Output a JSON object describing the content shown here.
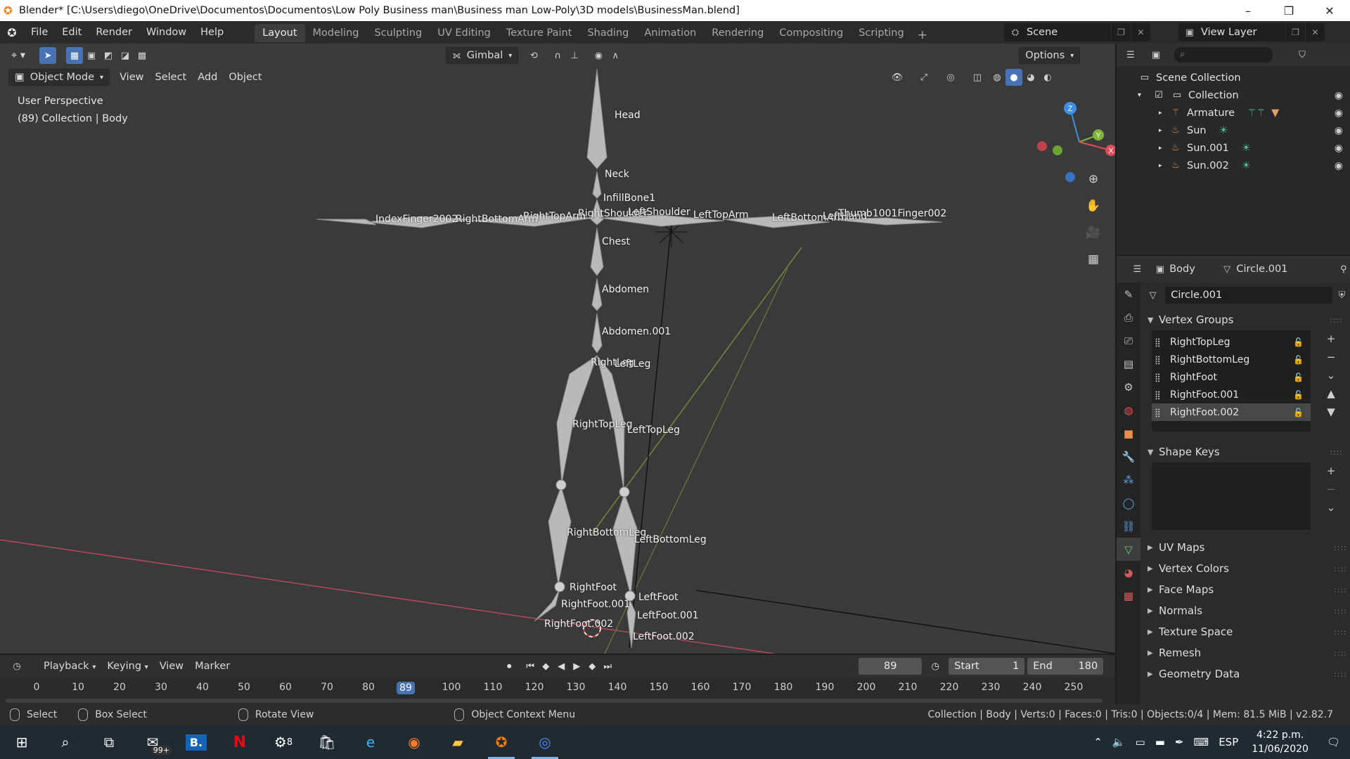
{
  "window": {
    "title": "Blender* [C:\\Users\\diego\\OneDrive\\Documentos\\Documentos\\Low Poly Business man\\Business man Low-Poly\\3D models\\BusinessMan.blend]",
    "minimize": "–",
    "maximize": "❐",
    "close": "✕"
  },
  "menu": [
    "File",
    "Edit",
    "Render",
    "Window",
    "Help"
  ],
  "workspaces": [
    "Layout",
    "Modeling",
    "Sculpting",
    "UV Editing",
    "Texture Paint",
    "Shading",
    "Animation",
    "Rendering",
    "Compositing",
    "Scripting"
  ],
  "active_workspace": "Layout",
  "add_workspace": "+",
  "scene": "Scene",
  "view_layer": "View Layer",
  "viewport": {
    "mode": "Object Mode",
    "menus": [
      "View",
      "Select",
      "Add",
      "Object"
    ],
    "orientation": "Gimbal",
    "options": "Options",
    "info_line1": "User Perspective",
    "info_line2": "(89) Collection | Body",
    "gizmo": {
      "z": "Z",
      "y": "Y",
      "x": "X"
    }
  },
  "bones": {
    "head": "Head",
    "neck": "Neck",
    "infill": "InfillBone1",
    "right_shoulder": "RightShoulder",
    "left_shoulder": "LeftShoulder",
    "right_top_arm": "RightTopArm",
    "left_top_arm": "LeftTopArm",
    "right_bottom_arm": "RightBottomArm",
    "left_bottom_arm": "LeftBottomArm",
    "left_hand": "LeftHand",
    "left_fingers_overlap": "Thumb1001Finger002",
    "right_fingers_overlap": "IndexFinger2002",
    "chest": "Chest",
    "abdomen": "Abdomen",
    "abdomen001": "Abdomen.001",
    "right_leg": "RightLeg",
    "left_leg": "LeftLeg",
    "right_top_leg": "RightTopLeg",
    "left_top_leg": "LeftTopLeg",
    "right_bottom_leg": "RightBottomLeg",
    "left_bottom_leg": "LeftBottomLeg",
    "right_foot": "RightFoot",
    "right_foot001": "RightFoot.001",
    "right_foot002": "RightFoot.002",
    "left_foot": "LeftFoot",
    "left_foot001": "LeftFoot.001",
    "left_foot002": "LeftFoot.002"
  },
  "outliner": {
    "root": "Scene Collection",
    "collection": "Collection",
    "items": [
      "Armature",
      "Sun",
      "Sun.001",
      "Sun.002"
    ]
  },
  "properties": {
    "object": "Body",
    "mesh": "Circle.001",
    "mesh_field": "Circle.001",
    "vertex_groups_title": "Vertex Groups",
    "vertex_groups": [
      "RightTopLeg",
      "RightBottomLeg",
      "RightFoot",
      "RightFoot.001",
      "RightFoot.002"
    ],
    "selected_vertex_group": "RightFoot.002",
    "shape_keys_title": "Shape Keys",
    "collapsed_panels": [
      "UV Maps",
      "Vertex Colors",
      "Face Maps",
      "Normals",
      "Texture Space",
      "Remesh",
      "Geometry Data"
    ]
  },
  "timeline": {
    "menus": [
      "Playback",
      "Keying",
      "View",
      "Marker"
    ],
    "current_frame": "89",
    "start_label": "Start",
    "start": "1",
    "end_label": "End",
    "end": "180",
    "ticks": [
      "0",
      "10",
      "20",
      "30",
      "40",
      "50",
      "60",
      "70",
      "80",
      "89",
      "100",
      "110",
      "120",
      "130",
      "140",
      "150",
      "160",
      "170",
      "180",
      "190",
      "200",
      "210",
      "220",
      "230",
      "240",
      "250"
    ]
  },
  "statusbar": {
    "select": "Select",
    "box_select": "Box Select",
    "rotate_view": "Rotate View",
    "context_menu": "Object Context Menu",
    "stats": "Collection | Body | Verts:0 | Faces:0 | Tris:0 | Objects:0/4 | Mem: 81.5 MiB | v2.82.7"
  },
  "taskbar": {
    "mail_badge": "99+",
    "b_app": "B.",
    "netflix": "N",
    "badge8": "8",
    "language": "ESP",
    "time": "4:22 p.m.",
    "date": "11/06/2020"
  },
  "colors": {
    "accent": "#4772b3",
    "viewport_bg": "#3a3a3a",
    "x_axis": "#e24b5a",
    "y_axis": "#7fb33a",
    "z_axis": "#3f8ee0"
  }
}
